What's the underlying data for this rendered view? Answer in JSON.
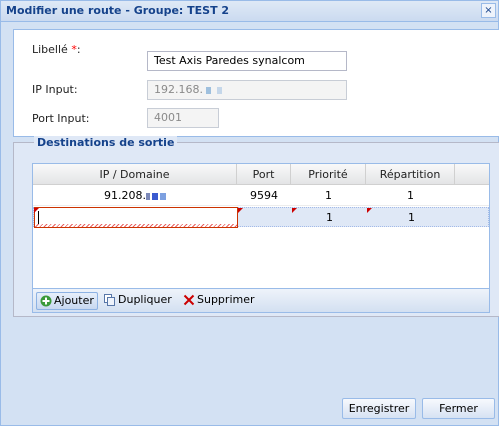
{
  "window": {
    "title": "Modifier une route - Groupe: TEST 2",
    "close_symbol": "×"
  },
  "form": {
    "libelle": {
      "label": "Libellé ",
      "required_mark": "*",
      "label_suffix": ":",
      "value": "Test Axis  Paredes synalcom"
    },
    "ip_input": {
      "label": "IP Input:",
      "value": "192.168."
    },
    "port_input": {
      "label": "Port Input:",
      "value": "4001"
    }
  },
  "destinations": {
    "legend": "Destinations de sortie",
    "columns": [
      "IP / Domaine",
      "Port",
      "Priorité",
      "Répartition"
    ],
    "rows": [
      {
        "ip": "91.208.",
        "port": "9594",
        "priorite": "1",
        "repartition": "1"
      },
      {
        "ip": "",
        "port": "",
        "priorite": "1",
        "repartition": "1"
      }
    ],
    "toolbar": {
      "add_label": "Ajouter",
      "duplicate_label": "Dupliquer",
      "delete_label": "Supprimer"
    }
  },
  "footer": {
    "save_label": "Enregistrer",
    "close_label": "Fermer"
  },
  "colors": {
    "title_text": "#15428b",
    "panel_border": "#99bbe8",
    "required": "#ff0000",
    "dirty_marker": "#cc0000",
    "delete_icon": "#cc0000",
    "add_icon": "#3a9a3a"
  }
}
